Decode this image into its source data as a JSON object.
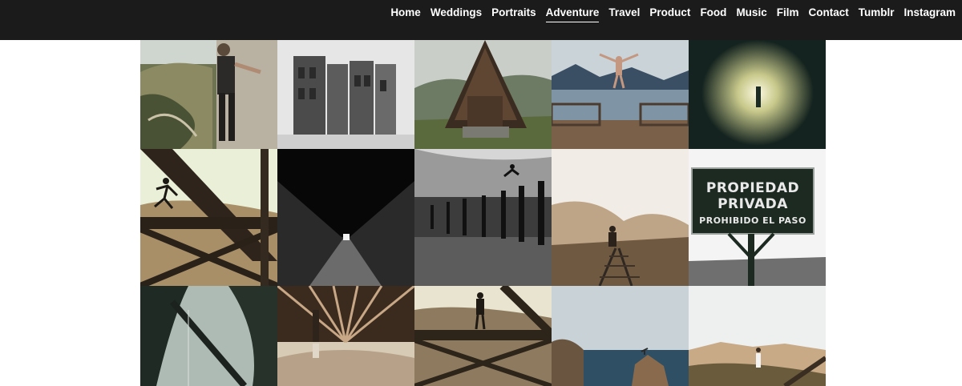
{
  "nav": {
    "items": [
      {
        "label": "Home",
        "active": false
      },
      {
        "label": "Weddings",
        "active": false
      },
      {
        "label": "Portraits",
        "active": false
      },
      {
        "label": "Adventure",
        "active": true
      },
      {
        "label": "Travel",
        "active": false
      },
      {
        "label": "Product",
        "active": false
      },
      {
        "label": "Food",
        "active": false
      },
      {
        "label": "Music",
        "active": false
      },
      {
        "label": "Film",
        "active": false
      },
      {
        "label": "Contact",
        "active": false
      },
      {
        "label": "Tumblr",
        "active": false
      },
      {
        "label": "Instagram",
        "active": false
      }
    ]
  },
  "gallery": {
    "sign": {
      "line1": "PROPIEDAD",
      "line2": "PRIVADA",
      "line3": "PROHIBIDO EL PASO"
    }
  },
  "colors": {
    "header_bg": "#1b1b1b",
    "nav_text": "#ffffff",
    "page_bg": "#ffffff"
  }
}
